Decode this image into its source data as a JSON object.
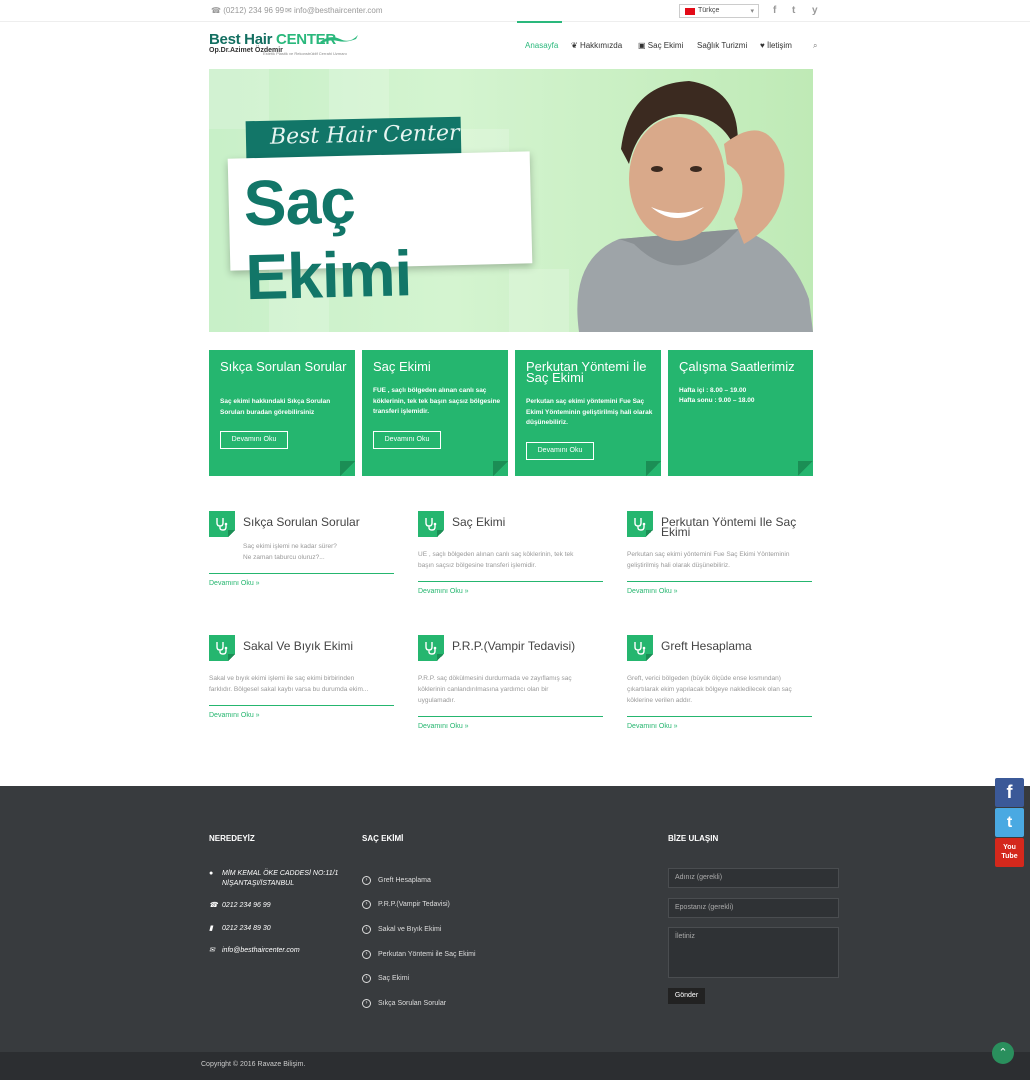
{
  "topbar": {
    "phone": "(0212) 234 96 99",
    "email": "info@besthaircenter.com",
    "language": "Türkçe",
    "social": [
      "f",
      "t",
      "y"
    ]
  },
  "logo": {
    "brand_main": "Best Hair",
    "brand_accent": "CENTER",
    "doctor": "Op.Dr.Azimet Özdemir",
    "tagline": "Estetik Plastik ve Rekonstrüktif Cerrahi Uzmanı"
  },
  "nav": {
    "items": [
      "Anasayfa",
      "Hakkımızda",
      "Saç Ekimi",
      "Sağlık Turizmi",
      "İletişim"
    ],
    "active": "Anasayfa"
  },
  "hero": {
    "ribbon": "Best Hair Center",
    "title": "Saç Ekimi"
  },
  "boxes": [
    {
      "title": "Sıkça Sorulan Sorular",
      "text": "Saç ekimi hakkındaki Sıkça Sorulan Soruları buradan görebilirsiniz",
      "button": "Devamını Oku"
    },
    {
      "title": "Saç Ekimi",
      "text": "FUE , saçlı bölgeden alınan canlı saç köklerinin, tek tek başın saçsız bölgesine transferi işlemidir.",
      "button": "Devamını Oku"
    },
    {
      "title": "Perkutan Yöntemi İle Saç Ekimi",
      "text": "Perkutan saç ekimi yöntemini Fue Saç Ekimi Yönteminin geliştirilmiş hali olarak düşünebiliriz.",
      "button": "Devamını Oku"
    },
    {
      "title": "Çalışma Saatlerimiz",
      "text": "Hafta içi : 8.00 – 19.00",
      "text2": "Hafta sonu : 9.00 – 18.00"
    }
  ],
  "features": [
    {
      "title": "Sıkça Sorulan Sorular",
      "text1": "Saç ekimi işlemi ne kadar sürer?",
      "text2": "Ne zaman taburcu oluruz?...",
      "more": "Devamını Oku »"
    },
    {
      "title": "Saç Ekimi",
      "text1": "UE , saçlı bölgeden alınan canlı saç köklerinin, tek tek",
      "text2": "başın saçsız bölgesine transferi işlemidir.",
      "more": "Devamını Oku »"
    },
    {
      "title": "Perkutan Yöntemi Ile Saç Ekimi",
      "text1": "Perkutan saç ekimi yöntemini Fue Saç Ekimi Yönteminin",
      "text2": "geliştirilmiş hali olarak düşünebiliriz.",
      "more": "Devamını Oku »"
    },
    {
      "title": "Sakal Ve Bıyık Ekimi",
      "text1": "Sakal ve bıyık ekimi işlemi ile saç ekimi birbirinden",
      "text2": "farklıdır. Bölgesel sakal kaybı varsa bu durumda ekim...",
      "more": "Devamını Oku »"
    },
    {
      "title": "P.R.P.(Vampir Tedavisi)",
      "text1": "P.R.P. saç dökülmesini durdurmada ve zayıflamış saç",
      "text2": "köklerinin canlandırılmasına yardımcı olan bir",
      "text3": "uygulamadır.",
      "more": "Devamını Oku »"
    },
    {
      "title": "Greft Hesaplama",
      "text1": "Greft, verici bölgeden (büyük ölçüde ense kısmından)",
      "text2": "çıkartılarak ekim yapılacak bölgeye nakledilecek olan saç",
      "text3": "köklerine verilen addır.",
      "more": "Devamını Oku »"
    }
  ],
  "footer": {
    "col1_title": "NEREDEYİZ",
    "address1": "MİM KEMAL ÖKE CADDESİ NO:11/1",
    "address2": "NİŞANTAŞI/İSTANBUL",
    "phone": "0212 234 96 99",
    "fax": "0212 234 89 30",
    "email": "info@besthaircenter.com",
    "col2_title": "SAÇ EKİMİ",
    "links": [
      "Greft Hesaplama",
      "P.R.P.(Vampir Tedavisi)",
      "Sakal ve Bıyık Ekimi",
      "Perkutan Yöntemi ile Saç Ekimi",
      "Saç Ekimi",
      "Sıkça Sorulan Sorular"
    ],
    "col3_title": "BİZE ULAŞIN",
    "name_placeholder": "Adınız (gerekli)",
    "email_placeholder": "Epostanız (gerekli)",
    "message_placeholder": "İletiniz",
    "send": "Gönder",
    "copyright": "Copyright © 2016 Ravaze Bilişim."
  },
  "side_social": [
    "f",
    "t",
    "You Tube"
  ],
  "colors": {
    "accent": "#25b66f",
    "dark_teal": "#127668",
    "footer": "#383b3e"
  }
}
